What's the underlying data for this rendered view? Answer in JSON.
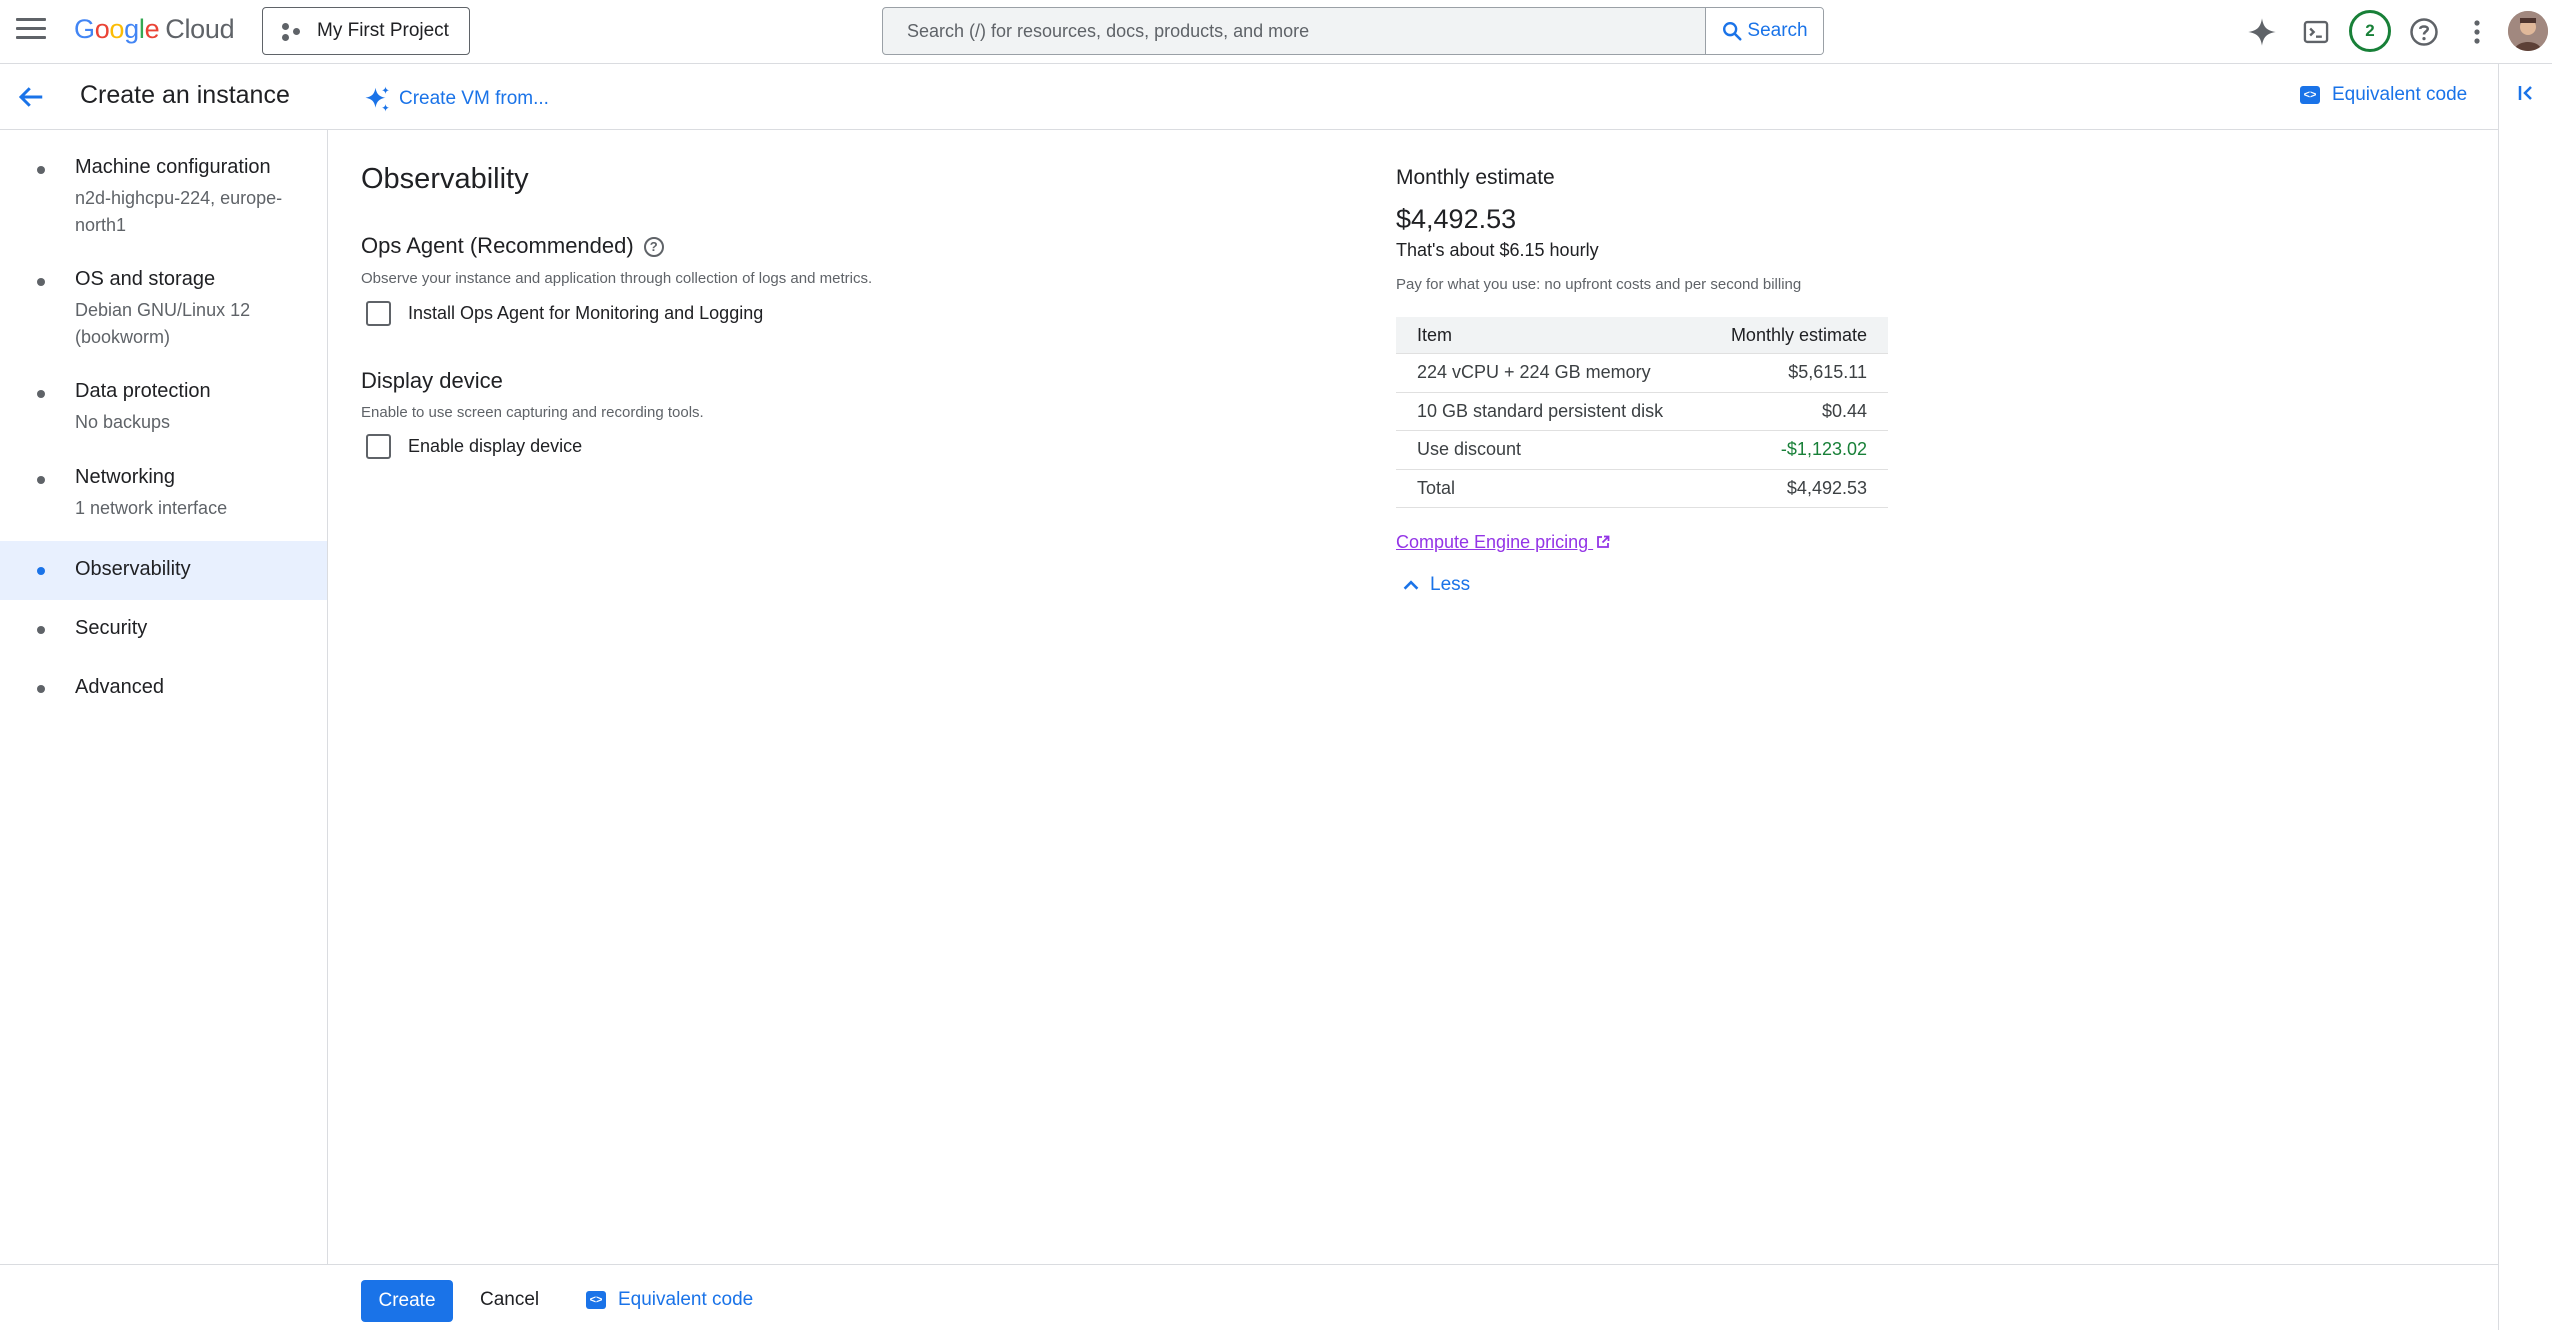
{
  "header": {
    "logo_letters": [
      "G",
      "o",
      "o",
      "g",
      "l",
      "e"
    ],
    "logo_cloud": "Cloud",
    "project": "My First Project",
    "search_placeholder": "Search (/) for resources, docs, products, and more",
    "search_button": "Search",
    "notification_count": "2"
  },
  "subbar": {
    "title": "Create an instance",
    "create_from": "Create VM from...",
    "equivalent_code": "Equivalent code"
  },
  "sidebar": {
    "items": [
      {
        "title": "Machine configuration",
        "subtitle": "n2d-highcpu-224, europe-north1"
      },
      {
        "title": "OS and storage",
        "subtitle": "Debian GNU/Linux 12 (bookworm)"
      },
      {
        "title": "Data protection",
        "subtitle": "No backups"
      },
      {
        "title": "Networking",
        "subtitle": "1 network interface"
      },
      {
        "title": "Observability",
        "subtitle": ""
      },
      {
        "title": "Security",
        "subtitle": ""
      },
      {
        "title": "Advanced",
        "subtitle": ""
      }
    ],
    "active_index": 4
  },
  "main": {
    "section_title": "Observability",
    "ops_agent": {
      "heading": "Ops Agent (Recommended)",
      "description": "Observe your instance and application through collection of logs and metrics.",
      "checkbox_label": "Install Ops Agent for Monitoring and Logging",
      "checked": false
    },
    "display_device": {
      "heading": "Display device",
      "description": "Enable to use screen capturing and recording tools.",
      "checkbox_label": "Enable display device",
      "checked": false
    }
  },
  "estimate": {
    "title": "Monthly estimate",
    "price": "$4,492.53",
    "hourly": "That's about $6.15 hourly",
    "note": "Pay for what you use: no upfront costs and per second billing",
    "table_headers": [
      "Item",
      "Monthly estimate"
    ],
    "rows": [
      {
        "item": "224 vCPU + 224 GB memory",
        "cost": "$5,615.11"
      },
      {
        "item": "10 GB standard persistent disk",
        "cost": "$0.44"
      },
      {
        "item": "Use discount",
        "cost": "-$1,123.02"
      },
      {
        "item": "Total",
        "cost": "$4,492.53"
      }
    ],
    "pricing_link": "Compute Engine pricing",
    "less_label": "Less"
  },
  "footer": {
    "create": "Create",
    "cancel": "Cancel",
    "equivalent_code": "Equivalent code"
  },
  "colors": {
    "accent": "#1a73e8",
    "active_bg": "#e8f0fe",
    "discount": "#188038",
    "link_visited": "#9334e6"
  }
}
